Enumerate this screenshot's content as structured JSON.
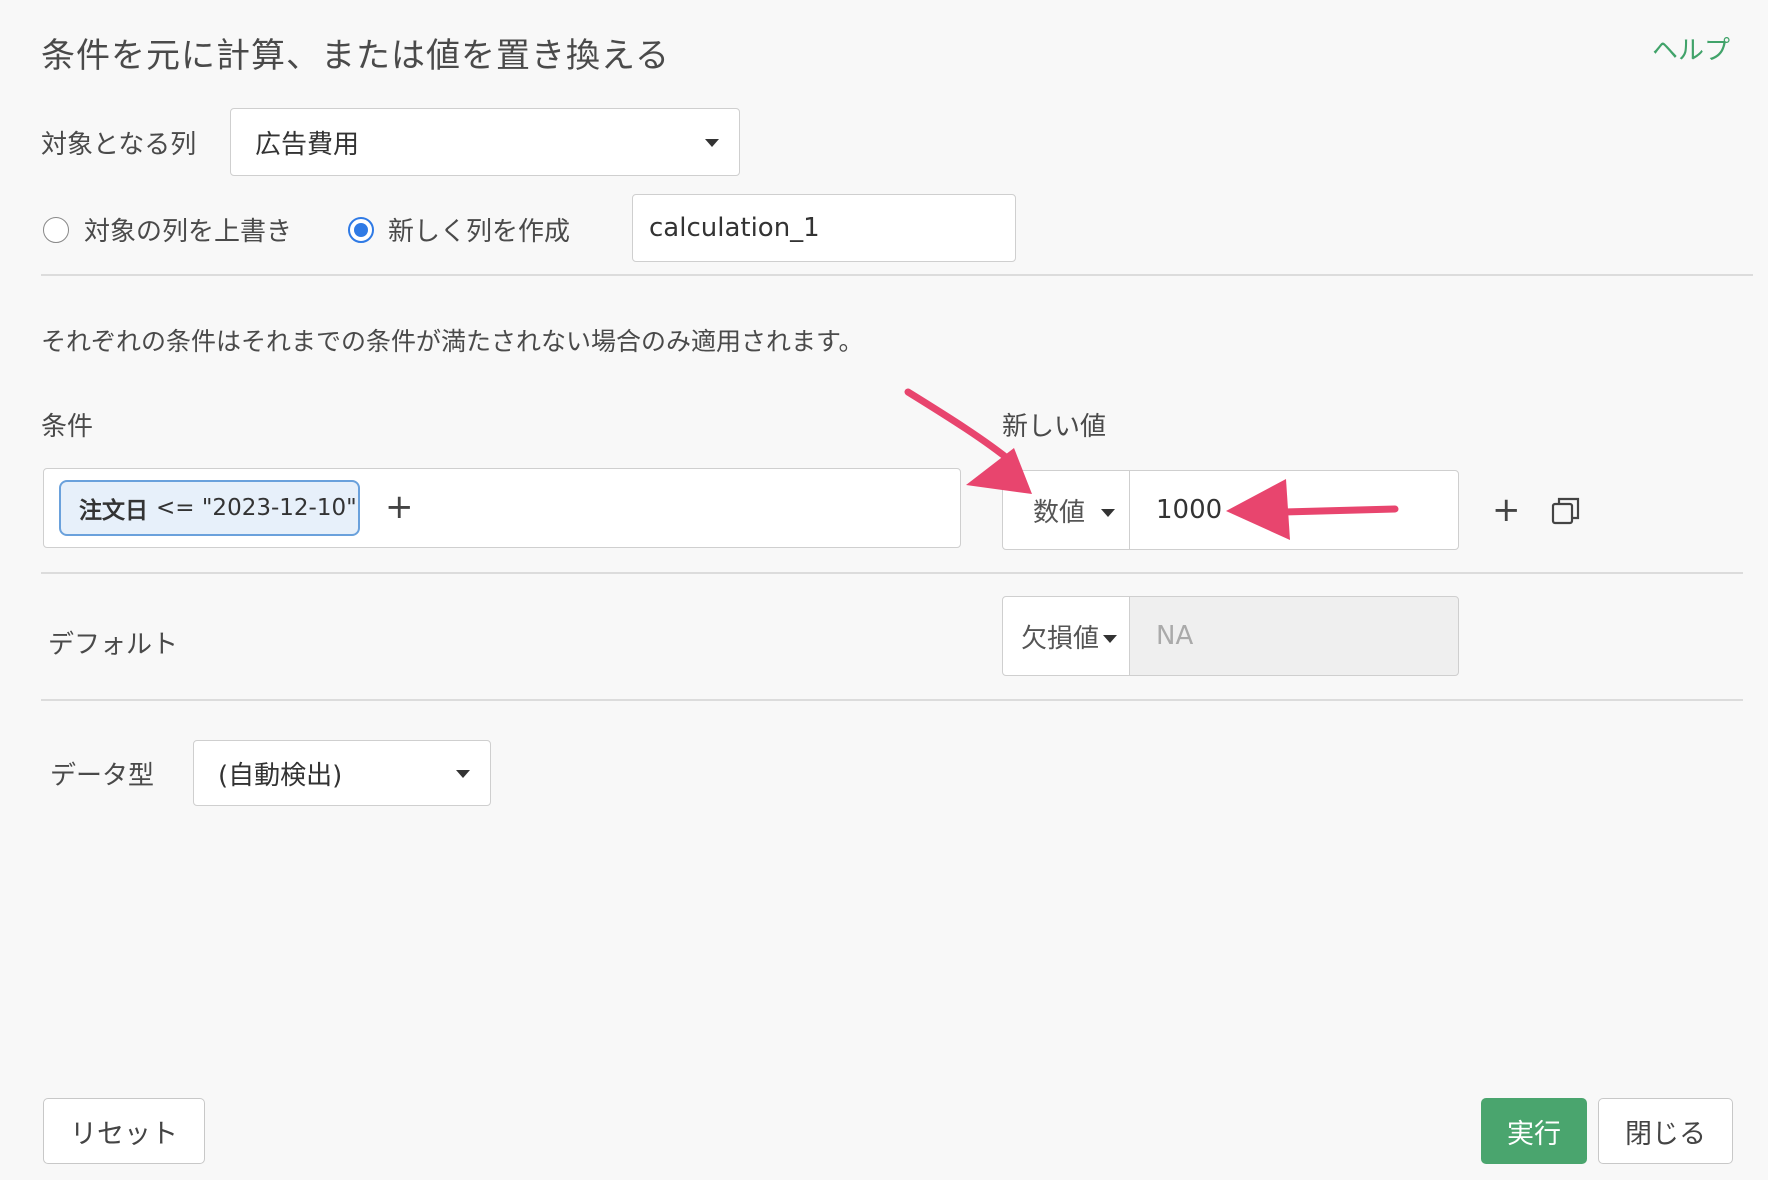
{
  "title": "条件を元に計算、または値を置き換える",
  "help_label": "ヘルプ",
  "target_column": {
    "label": "対象となる列",
    "value": "広告費用"
  },
  "output": {
    "overwrite_label": "対象の列を上書き",
    "create_label": "新しく列を作成",
    "selected": "create",
    "new_column_name": "calculation_1"
  },
  "note": "それぞれの条件はそれまでの条件が満たされない場合のみ適用されます。",
  "headers": {
    "condition": "条件",
    "new_value": "新しい値"
  },
  "condition_row": {
    "chip_column": "注文日",
    "chip_expression": "<= \"2023-12-10\"",
    "add_symbol": "+",
    "value_type": "数値",
    "value": "1000"
  },
  "default_row": {
    "label": "デフォルト",
    "value_type": "欠損値",
    "value": "NA"
  },
  "data_type": {
    "label": "データ型",
    "value": "(自動検出)"
  },
  "buttons": {
    "reset": "リセット",
    "run": "実行",
    "close": "閉じる"
  },
  "colors": {
    "accent_green": "#4aa56e",
    "radio_blue": "#2f7ae5",
    "annotation_arrow": "#e8456e"
  }
}
